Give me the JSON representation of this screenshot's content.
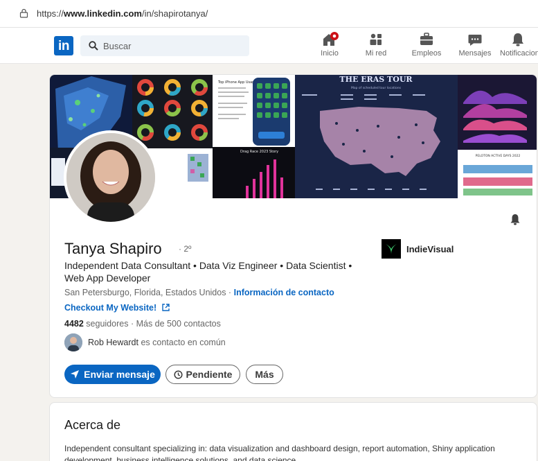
{
  "browser": {
    "url_prefix": "https://",
    "url_domain": "www.linkedin.com",
    "url_path": "/in/shapirotanya/"
  },
  "nav": {
    "logo": "in",
    "search_placeholder": "Buscar",
    "items": [
      {
        "label": "Inicio",
        "icon": "home-icon"
      },
      {
        "label": "Mi red",
        "icon": "network-icon"
      },
      {
        "label": "Empleos",
        "icon": "briefcase-icon"
      },
      {
        "label": "Mensajes",
        "icon": "messaging-icon"
      },
      {
        "label": "Notificacion",
        "icon": "bell-icon"
      }
    ]
  },
  "banner": {
    "eras_title_top": "THE ERAS TOUR",
    "eras_subtitle": "Map of scheduled tour locations"
  },
  "profile": {
    "name": "Tanya Shapiro",
    "degree": "· 2º",
    "headline": "Independent Data Consultant • Data Viz Engineer • Data Scientist • Web App Developer",
    "location": "San Petersburgo, Florida, Estados Unidos ·",
    "contact_link": "Información de contacto",
    "website": "Checkout My Website!",
    "followers_count": "4482",
    "followers_label": "seguidores",
    "connections": "· Más de 500 contactos",
    "mutual_name": "Rob Hewardt",
    "mutual_suffix": "es contacto en común",
    "company": "IndieVisual"
  },
  "actions": {
    "message": "Enviar mensaje",
    "pending": "Pendiente",
    "more": "Más"
  },
  "about": {
    "title": "Acerca de",
    "text": "Independent consultant specializing in: data visualization and dashboard design, report automation, Shiny application development, business intelligence solutions, and data science."
  },
  "colors": {
    "brand": "#0a66c2",
    "notification": "#cc1016"
  }
}
